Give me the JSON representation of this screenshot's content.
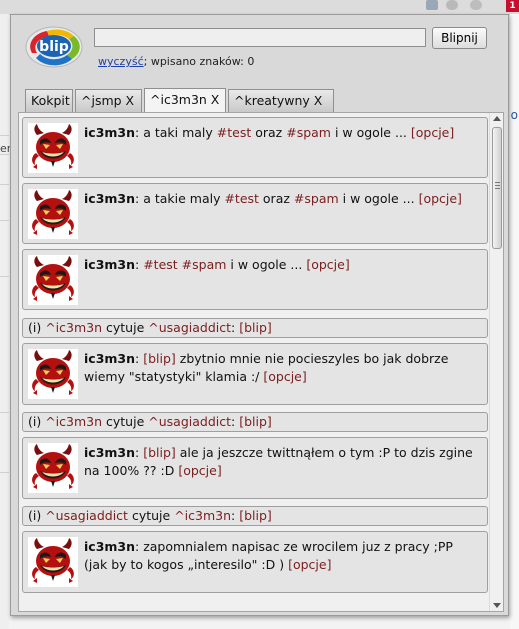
{
  "toolbar": {
    "badge_count": "1",
    "background_left_char": "en",
    "background_right_char": "o"
  },
  "popup": {
    "logo_text": "blip",
    "status_input": {
      "value": "",
      "placeholder": ""
    },
    "send_label": "Blipnij",
    "clear_link": "wyczyść",
    "char_count_label": "; wpisano znaków: 0"
  },
  "tabs": [
    {
      "label": "Kokpit",
      "active": false
    },
    {
      "label": "^jsmp X",
      "active": false
    },
    {
      "label": "^ic3m3n X",
      "active": true
    },
    {
      "label": "^kreatywny X",
      "active": false
    }
  ],
  "feed": {
    "posts": [
      {
        "author": "ic3m3n",
        "sep": ": ",
        "segs": [
          "a taki maly ",
          "#test",
          " oraz ",
          "#spam",
          " i w ogole ... "
        ],
        "options": "[opcje]"
      },
      {
        "author": "ic3m3n",
        "sep": ": ",
        "segs": [
          "a takie maly ",
          "#test",
          " oraz ",
          "#spam",
          " i w ogole ... "
        ],
        "options": "[opcje]"
      },
      {
        "author": "ic3m3n",
        "sep": ": ",
        "segs": [
          "#test",
          " ",
          "#spam",
          " i w ogole ... "
        ],
        "options": "[opcje]"
      },
      {
        "author": "ic3m3n",
        "sep": ": ",
        "segs": [
          "[blip]",
          " zbytnio mnie nie pocieszyles bo jak dobrze wiemy \"statystyki\" klamia :/ "
        ],
        "options": "[opcje]"
      },
      {
        "author": "ic3m3n",
        "sep": ": ",
        "segs": [
          "[blip]",
          " ale ja jeszcze twittnąłem o tym :P to dzis zgine na 100% ?? :D "
        ],
        "options": "[opcje]"
      },
      {
        "author": "ic3m3n",
        "sep": ": ",
        "segs": [
          "zapomnialem napisac ze wrocilem juz z pracy ;PP (jak by to kogos „interesilo\" :D ) "
        ],
        "options": "[opcje]"
      }
    ],
    "quotes": [
      {
        "prefix": "(i) ",
        "from": "^ic3m3n",
        "verb": " cytuje ",
        "to": "^usagiaddict",
        "colon": ": ",
        "link": "[blip]"
      },
      {
        "prefix": "(i) ",
        "from": "^ic3m3n",
        "verb": " cytuje ",
        "to": "^usagiaddict",
        "colon": ": ",
        "link": "[blip]"
      },
      {
        "prefix": "(i) ",
        "from": "^usagiaddict",
        "verb": " cytuje ",
        "to": "^ic3m3n",
        "colon": ": ",
        "link": "[blip]"
      }
    ]
  },
  "colors": {
    "link_dark_red": "#7a1e1e",
    "clear_link_blue": "#1f3fa8",
    "panel_gray": "#d9d9d9"
  },
  "icons": [
    "blip-logo-icon",
    "devil-avatar-icon",
    "scroll-up-arrow-icon",
    "scroll-down-arrow-icon"
  ]
}
